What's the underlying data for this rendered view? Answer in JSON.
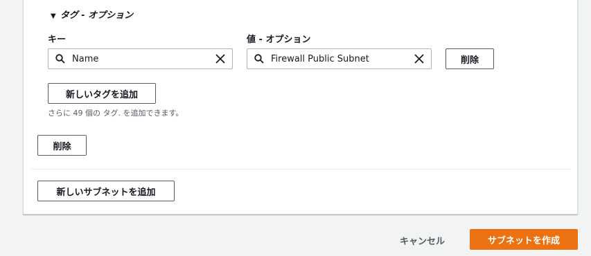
{
  "tags_section": {
    "title": "タグ - オプション",
    "key_label": "キー",
    "value_label": "値 - オプション",
    "key_value": "Name",
    "value_value": "Firewall Public Subnet",
    "remove_tag_label": "削除",
    "add_tag_label": "新しいタグを追加",
    "remaining_hint": "さらに 49 個の タグ. を追加できます。"
  },
  "subnet": {
    "remove_label": "削除",
    "add_subnet_label": "新しいサブネットを追加"
  },
  "footer": {
    "cancel_label": "キャンセル",
    "create_label": "サブネットを作成"
  },
  "colors": {
    "accent": "#ec7211",
    "border": "#aab7b8",
    "button_border": "#545b64"
  },
  "icons": [
    "caret-down-icon",
    "search-icon",
    "clear-icon"
  ]
}
